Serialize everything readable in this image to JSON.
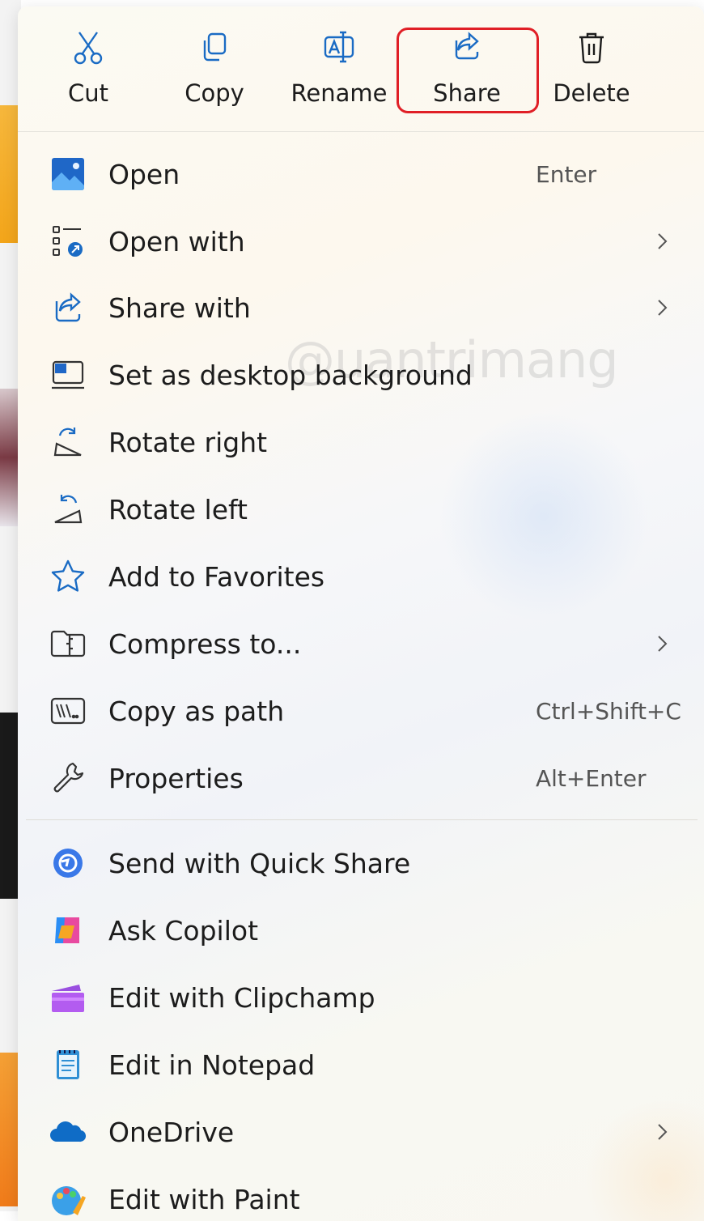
{
  "toolbar": {
    "cut": "Cut",
    "copy": "Copy",
    "rename": "Rename",
    "share": "Share",
    "delete": "Delete"
  },
  "menu_items": [
    {
      "label": "Open",
      "shortcut": "Enter",
      "icon": "image-icon"
    },
    {
      "label": "Open with",
      "icon": "open-with-icon",
      "submenu": true
    },
    {
      "label": "Share with",
      "icon": "share-icon",
      "submenu": true
    },
    {
      "label": "Set as desktop background",
      "icon": "desktop-icon"
    },
    {
      "label": "Rotate right",
      "icon": "rotate-right-icon"
    },
    {
      "label": "Rotate left",
      "icon": "rotate-left-icon"
    },
    {
      "label": "Add to Favorites",
      "icon": "star-icon"
    },
    {
      "label": "Compress to...",
      "icon": "zip-icon",
      "submenu": true
    },
    {
      "label": "Copy as path",
      "shortcut": "Ctrl+Shift+C",
      "icon": "path-icon"
    },
    {
      "label": "Properties",
      "shortcut": "Alt+Enter",
      "icon": "wrench-icon"
    },
    {
      "label": "Send with Quick Share",
      "icon": "quick-share-icon"
    },
    {
      "label": "Ask Copilot",
      "icon": "copilot-icon"
    },
    {
      "label": "Edit with Clipchamp",
      "icon": "clipchamp-icon"
    },
    {
      "label": "Edit in Notepad",
      "icon": "notepad-icon"
    },
    {
      "label": "OneDrive",
      "icon": "onedrive-icon",
      "submenu": true
    },
    {
      "label": "Edit with Paint",
      "icon": "paint-icon"
    }
  ],
  "colors": {
    "accent": "#0067c0",
    "highlight_border": "#e01f26"
  }
}
